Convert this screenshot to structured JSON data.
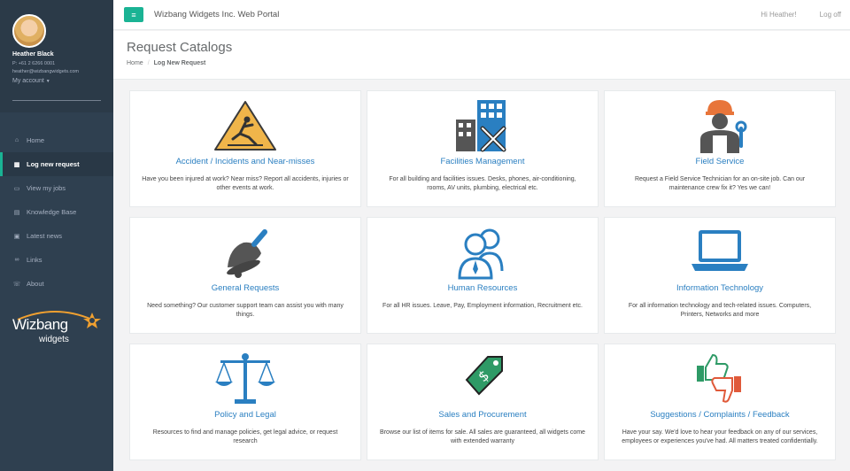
{
  "profile": {
    "name": "Heather Black",
    "phone": "P: +61 2 6266 0001",
    "email": "heather@wizbangwidgets.com",
    "account": "My account"
  },
  "nav": [
    {
      "label": "Home",
      "icon": "home-icon",
      "glyph": "⌂"
    },
    {
      "label": "Log new request",
      "icon": "grid-icon",
      "glyph": "▦"
    },
    {
      "label": "View my jobs",
      "icon": "monitor-icon",
      "glyph": "▭"
    },
    {
      "label": "Knowledge Base",
      "icon": "book-icon",
      "glyph": "▤"
    },
    {
      "label": "Latest news",
      "icon": "newspaper-icon",
      "glyph": "▣"
    },
    {
      "label": "Links",
      "icon": "link-icon",
      "glyph": "∞"
    },
    {
      "label": "About",
      "icon": "phone-icon",
      "glyph": "☏"
    }
  ],
  "logo": {
    "word": "Wizbang",
    "sub": "widgets"
  },
  "topbar": {
    "menu_glyph": "≡",
    "title": "Wizbang Widgets Inc. Web Portal",
    "greeting": "Hi Heather!",
    "logoff": "Log off"
  },
  "heading": {
    "title": "Request Catalogs",
    "crumb_home": "Home",
    "crumb_sep": "/",
    "crumb_current": "Log New Request"
  },
  "catalogs": [
    {
      "title": "Accident / Incidents and Near-misses",
      "desc": "Have you been injured at work? Near miss? Report all accidents, injuries or other events at work.",
      "icon": "warning-slip-icon"
    },
    {
      "title": "Facilities Management",
      "desc": "For all building and facilities issues. Desks, phones, air-conditioning, rooms, AV units, plumbing, electrical etc.",
      "icon": "building-tools-icon"
    },
    {
      "title": "Field Service",
      "desc": "Request a Field Service Technician for an on-site job. Can our maintenance crew fix it? Yes we can!",
      "icon": "technician-icon"
    },
    {
      "title": "General Requests",
      "desc": "Need something? Our customer support team can assist you with many things.",
      "icon": "bell-icon"
    },
    {
      "title": "Human Resources",
      "desc": "For all HR issues. Leave, Pay, Employment information, Recruitment etc.",
      "icon": "people-icon"
    },
    {
      "title": "Information Technology",
      "desc": "For all information technology and tech-related issues. Computers, Printers, Networks and more",
      "icon": "laptop-icon"
    },
    {
      "title": "Policy and Legal",
      "desc": "Resources to find and manage policies, get legal advice, or request research",
      "icon": "scales-icon"
    },
    {
      "title": "Sales and Procurement",
      "desc": "Browse our list of items for sale. All sales are guaranteed, all widgets come with extended warranty",
      "icon": "price-tag-icon"
    },
    {
      "title": "Suggestions / Complaints / Feedback",
      "desc": "Have your say. We'd love to hear your feedback on any of our services, employees or experiences you've had. All matters treated confidentially.",
      "icon": "thumbs-icon"
    }
  ],
  "colors": {
    "accent": "#1ab394",
    "link": "#2a7fc1",
    "sidebar": "#2f4050"
  }
}
